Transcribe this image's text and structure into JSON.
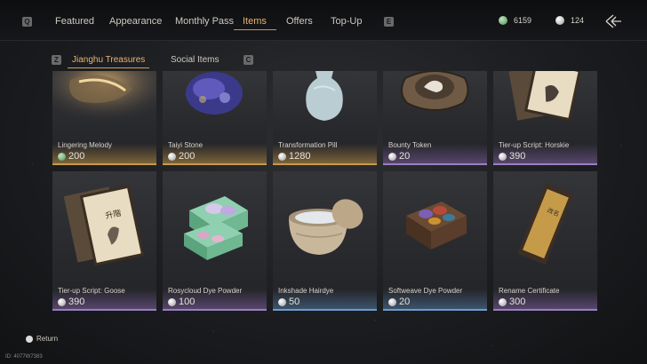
{
  "topbar": {
    "left_key": "Q",
    "right_key": "E",
    "tabs": [
      {
        "label": "Featured"
      },
      {
        "label": "Appearance"
      },
      {
        "label": "Monthly Pass"
      },
      {
        "label": "Items"
      },
      {
        "label": "Offers"
      },
      {
        "label": "Top-Up"
      }
    ],
    "active_tab": "Items",
    "jade_balance": "6159",
    "silver_balance": "124",
    "back_icon": "back-arrow-icon"
  },
  "subtabs": {
    "left_key": "Z",
    "right_key": "C",
    "items": [
      {
        "label": "Jianghu Treasures"
      },
      {
        "label": "Social Items"
      }
    ],
    "active": "Jianghu Treasures"
  },
  "items": [
    {
      "name": "Lingering Melody",
      "price": "200",
      "currency": "jade",
      "rarity": "gold"
    },
    {
      "name": "Taiyi Stone",
      "price": "200",
      "currency": "silver",
      "rarity": "gold"
    },
    {
      "name": "Transformation Pill",
      "price": "1280",
      "currency": "silver",
      "rarity": "gold"
    },
    {
      "name": "Bounty Token",
      "price": "20",
      "currency": "silver",
      "rarity": "purple"
    },
    {
      "name": "Tier-up Script: Horskie",
      "price": "390",
      "currency": "silver",
      "rarity": "purple"
    },
    {
      "name": "Tier-up Script: Goose",
      "price": "390",
      "currency": "silver",
      "rarity": "purple"
    },
    {
      "name": "Rosycloud Dye Powder",
      "price": "100",
      "currency": "silver",
      "rarity": "purple"
    },
    {
      "name": "Inkshade Hairdye",
      "price": "50",
      "currency": "silver",
      "rarity": "blue"
    },
    {
      "name": "Softweave Dye Powder",
      "price": "20",
      "currency": "silver",
      "rarity": "blue"
    },
    {
      "name": "Rename Certificate",
      "price": "300",
      "currency": "silver",
      "rarity": "purple"
    }
  ],
  "footer": {
    "return_label": "Return",
    "uid": "ID: 4077W7383"
  },
  "colors": {
    "accent": "#e8b470",
    "gold": "#c79a4e",
    "purple": "#9a7fc0",
    "blue": "#6e9ccc"
  }
}
